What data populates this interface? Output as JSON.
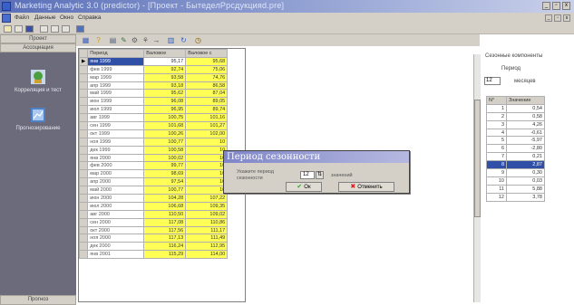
{
  "window": {
    "title": "Marketing Analytic 3.0 (predictor) - [Проект - БытеделРрсдукцияd.pre]",
    "buttons": [
      "_",
      "▫",
      "x"
    ]
  },
  "menubar": {
    "items": [
      "Файл",
      "Данные",
      "Окно",
      "Справка"
    ],
    "mdi_buttons": [
      "_",
      "▫",
      "x"
    ]
  },
  "sidebar": {
    "header": "Проект",
    "section": "Ассоциация",
    "items": [
      {
        "label": "Корреляция и тест",
        "icon": "correlation-icon"
      },
      {
        "label": "Прогнозирование",
        "icon": "forecast-icon"
      }
    ],
    "footer": "Прогноз"
  },
  "grid": {
    "columns": [
      "Период",
      "Валовое",
      "Валовое с"
    ],
    "rows": [
      [
        "янв 1999",
        "95,17",
        "95,68"
      ],
      [
        "фев 1999",
        "92,74",
        "75,06"
      ],
      [
        "мар 1999",
        "93,58",
        "74,76"
      ],
      [
        "апр 1999",
        "93,18",
        "86,58"
      ],
      [
        "май 1999",
        "95,62",
        "87,04"
      ],
      [
        "июн 1999",
        "96,08",
        "89,05"
      ],
      [
        "июл 1999",
        "96,95",
        "89,74"
      ],
      [
        "авг 1999",
        "100,75",
        "101,16"
      ],
      [
        "сен 1999",
        "101,68",
        "101,27"
      ],
      [
        "окт 1999",
        "100,26",
        "102,00"
      ],
      [
        "ноя 1999",
        "100,77",
        "10"
      ],
      [
        "дек 1999",
        "100,58",
        "10"
      ],
      [
        "янв 2000",
        "100,02",
        "10"
      ],
      [
        "фев 2000",
        "99,77",
        "10"
      ],
      [
        "мар 2000",
        "98,69",
        "10"
      ],
      [
        "апр 2000",
        "97,54",
        "10"
      ],
      [
        "май 2000",
        "100,77",
        "10"
      ],
      [
        "июн 2000",
        "104,28",
        "107,22"
      ],
      [
        "июл 2000",
        "106,68",
        "109,35"
      ],
      [
        "авг 2000",
        "110,50",
        "109,02"
      ],
      [
        "сен 2000",
        "117,08",
        "110,86"
      ],
      [
        "окт 2000",
        "117,56",
        "111,17"
      ],
      [
        "ноя 2000",
        "117,13",
        "111,49"
      ],
      [
        "дек 2000",
        "116,24",
        "112,95"
      ],
      [
        "янв 2001",
        "115,29",
        "114,00"
      ]
    ]
  },
  "right_panel": {
    "title": "Сезонные компоненты",
    "period_label": "Период",
    "period_value": "12",
    "period_unit": "месяцев",
    "columns": [
      "N°",
      "Значение"
    ],
    "rows": [
      [
        "1",
        "0,54"
      ],
      [
        "2",
        "0,58"
      ],
      [
        "3",
        "4,26"
      ],
      [
        "4",
        "-0,61"
      ],
      [
        "5",
        "-5,97"
      ],
      [
        "6",
        "-2,80"
      ],
      [
        "7",
        "0,21"
      ],
      [
        "8",
        "2,87"
      ],
      [
        "9",
        "0,30"
      ],
      [
        "10",
        "0,03"
      ],
      [
        "11",
        "5,88"
      ],
      [
        "12",
        "3,78"
      ]
    ]
  },
  "dialog": {
    "title": "Период сезонности",
    "label": "Укажите период сезонности",
    "value": "12",
    "unit": "значений",
    "ok_label": "Ок",
    "cancel_label": "Отменить"
  }
}
